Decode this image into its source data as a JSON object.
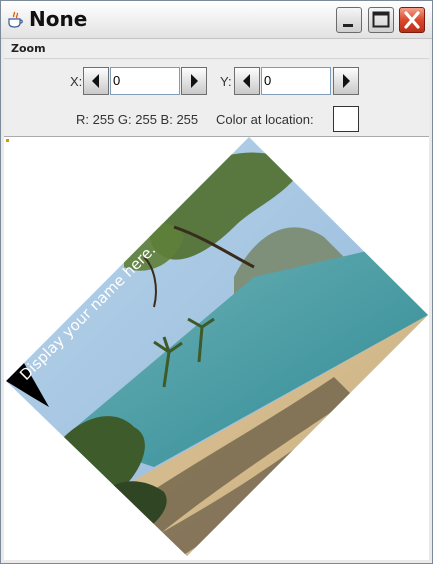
{
  "window": {
    "title": "None",
    "icon": "java-cup-icon",
    "buttons": {
      "minimize": "minimize-icon",
      "maximize": "maximize-icon",
      "close": "close-icon"
    }
  },
  "menubar": {
    "zoom_label": "Zoom"
  },
  "controls": {
    "x_label": "X:",
    "x_value": "0",
    "y_label": "Y:",
    "y_value": "0",
    "decrement_icon": "left-triangle-icon",
    "increment_icon": "right-triangle-icon",
    "rgb_text": "R: 255 G: 255 B: 255",
    "color_label": "Color at location:",
    "color_value": "#ffffff"
  },
  "image": {
    "description_icon": "rotated-beach-photo",
    "overlay_text": "Display your name here."
  },
  "colors": {
    "titlebar": "#f2f2f2",
    "close_button": "#d9482b",
    "panel_bg": "#eeeeee"
  }
}
